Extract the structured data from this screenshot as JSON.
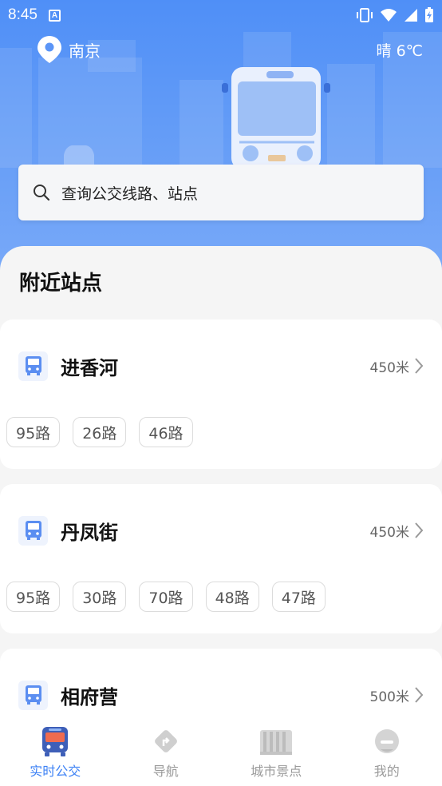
{
  "status_bar": {
    "time": "8:45",
    "notification_badge": "A"
  },
  "header": {
    "city": "南京",
    "weather": "晴 6℃"
  },
  "search": {
    "placeholder": "查询公交线路、站点"
  },
  "nearby": {
    "title": "附近站点",
    "stops": [
      {
        "name": "进香河",
        "distance": "450米",
        "routes": [
          "95路",
          "26路",
          "46路"
        ]
      },
      {
        "name": "丹凤街",
        "distance": "450米",
        "routes": [
          "95路",
          "30路",
          "70路",
          "48路",
          "47路"
        ]
      },
      {
        "name": "相府营",
        "distance": "500米",
        "routes": []
      }
    ]
  },
  "bottom_nav": {
    "items": [
      {
        "label": "实时公交",
        "icon": "bus-icon",
        "active": true
      },
      {
        "label": "导航",
        "icon": "navigation-icon",
        "active": false
      },
      {
        "label": "城市景点",
        "icon": "city-attraction-icon",
        "active": false
      },
      {
        "label": "我的",
        "icon": "profile-icon",
        "active": false
      }
    ]
  },
  "colors": {
    "accent": "#3e82f5",
    "header_bg": "#5b95f7"
  }
}
